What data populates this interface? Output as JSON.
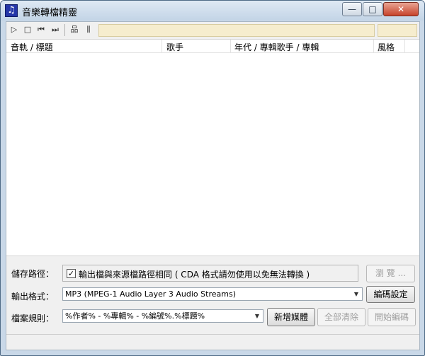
{
  "window": {
    "title": "音樂轉檔精靈",
    "app_icon_glyph": "♫",
    "minimize_glyph": "—",
    "maximize_glyph": "□",
    "close_glyph": "✕"
  },
  "toolbar": {
    "icons": [
      "play-icon",
      "stop-icon",
      "previous-icon",
      "next-icon",
      "network-icon",
      "equalizer-icon"
    ],
    "glyphs": {
      "play": "▷",
      "stop": "□",
      "previous": "⏮",
      "next": "⏭",
      "network": "品",
      "equalizer": "⫼"
    }
  },
  "list": {
    "columns": [
      "音軌 / 標題",
      "歌手",
      "年代 / 專輯歌手 / 專輯",
      "風格"
    ]
  },
  "save_path": {
    "label": "儲存路徑：",
    "checked": true,
    "check_glyph": "✓",
    "checkbox_text": "輸出檔與來源檔路徑相同 ( CDA 格式請勿使用以免無法轉換 )",
    "browse_label": "瀏 覽 ..."
  },
  "output_format": {
    "label": "輸出格式：",
    "value": "MP3  (MPEG-1 Audio Layer 3 Audio Streams)",
    "encode_settings_label": "編碼設定"
  },
  "file_rule": {
    "label": "檔案規則：",
    "value": "%作者% - %專輯% - %編號%.%標題%",
    "add_media_label": "新增媒體",
    "clear_all_label": "全部清除",
    "start_encode_label": "開始編碼"
  },
  "colors": {
    "titlebar": "#c9d8e8",
    "close_button": "#c7432b",
    "status_field": "#f6edce"
  }
}
